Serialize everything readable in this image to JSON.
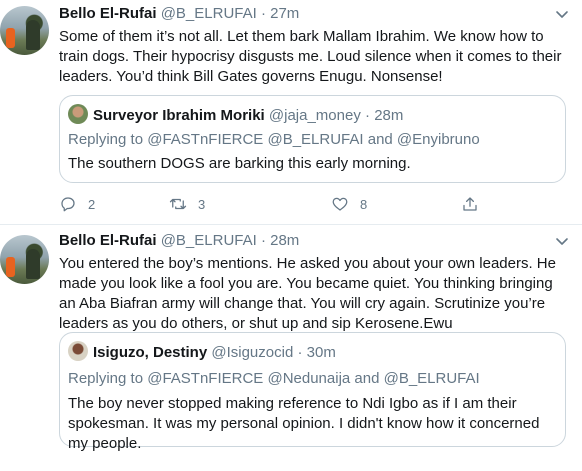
{
  "tweets": [
    {
      "name": "Bello El-Rufai",
      "handle": "@B_ELRUFAI",
      "separator": "·",
      "time": "27m",
      "text": "Some of them it’s not all. Let them bark Mallam Ibrahim. We know how to train dogs. Their hypocrisy disgusts me. Loud silence when it comes to their leaders. You’d think Bill Gates governs Enugu. Nonsense!",
      "quote": {
        "name": "Surveyor Ibrahim Moriki",
        "handle": "@jaja_money",
        "separator": "·",
        "time": "28m",
        "replying": "Replying to @FASTnFIERCE @B_ELRUFAI and @Enyibruno",
        "text": "The southern DOGS are barking this early morning."
      },
      "actions": {
        "replies": "2",
        "retweets": "3",
        "likes": "8"
      }
    },
    {
      "name": "Bello El-Rufai",
      "handle": "@B_ELRUFAI",
      "separator": "·",
      "time": "28m",
      "text": "You entered the boy’s mentions. He asked you about your own leaders. He made you look like a fool you are. You became quiet. You thinking bringing an Aba Biafran army will change that. You will cry again. Scrutinize you’re leaders as you do others, or shut up and sip Kerosene.Ewu",
      "quote": {
        "name": "Isiguzo, Destiny",
        "handle": "@Isiguzocid",
        "separator": "·",
        "time": "30m",
        "replying": "Replying to @FASTnFIERCE @Nedunaija and @B_ELRUFAI",
        "text": "The boy never stopped making reference to Ndi Igbo as if I am their spokesman. It was my personal opinion. I didn't know how it concerned my people."
      }
    }
  ],
  "icons": {
    "reply": "reply-icon",
    "retweet": "retweet-icon",
    "like": "like-icon",
    "share": "share-icon",
    "more": "chevron-down-icon"
  },
  "colors": {
    "text": "#14171a",
    "secondary": "#657786",
    "border": "#ccd6dd",
    "divider": "#e6ecf0"
  }
}
